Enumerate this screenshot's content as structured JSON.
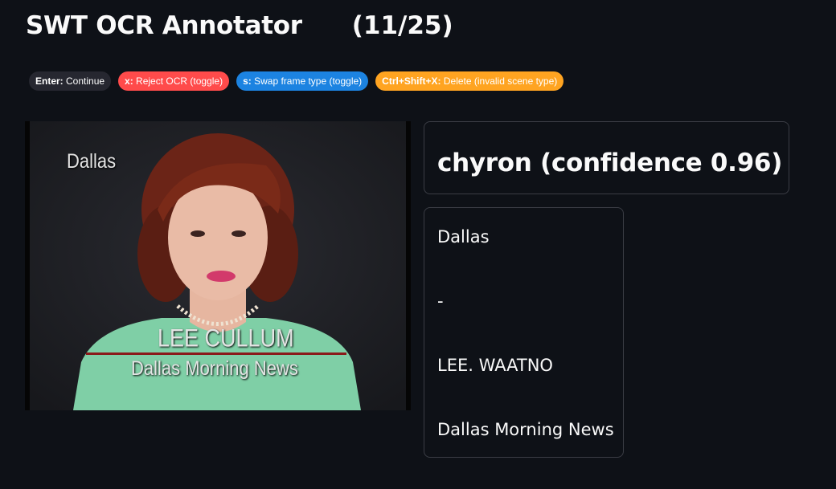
{
  "header": {
    "title": "SWT OCR Annotator",
    "counter": "(11/25)"
  },
  "shortcuts": [
    {
      "key": "Enter:",
      "label": " Continue",
      "color": "#262730"
    },
    {
      "key": "x:",
      "label": " Reject OCR (toggle)",
      "color": "#ff4b4b"
    },
    {
      "key": "s:",
      "label": " Swap frame type (toggle)",
      "color": "#1c83e1"
    },
    {
      "key": "Ctrl+Shift+X:",
      "label": " Delete (invalid scene type)",
      "color": "#ffa421"
    }
  ],
  "frame": {
    "location_text": "Dallas",
    "name_text": "LEE CULLUM",
    "org_text": "Dallas Morning News"
  },
  "prediction": {
    "label": "chyron (confidence 0.96)"
  },
  "ocr_lines": [
    "Dallas",
    "-",
    "LEE. WAATNO",
    "Dallas Morning News"
  ]
}
